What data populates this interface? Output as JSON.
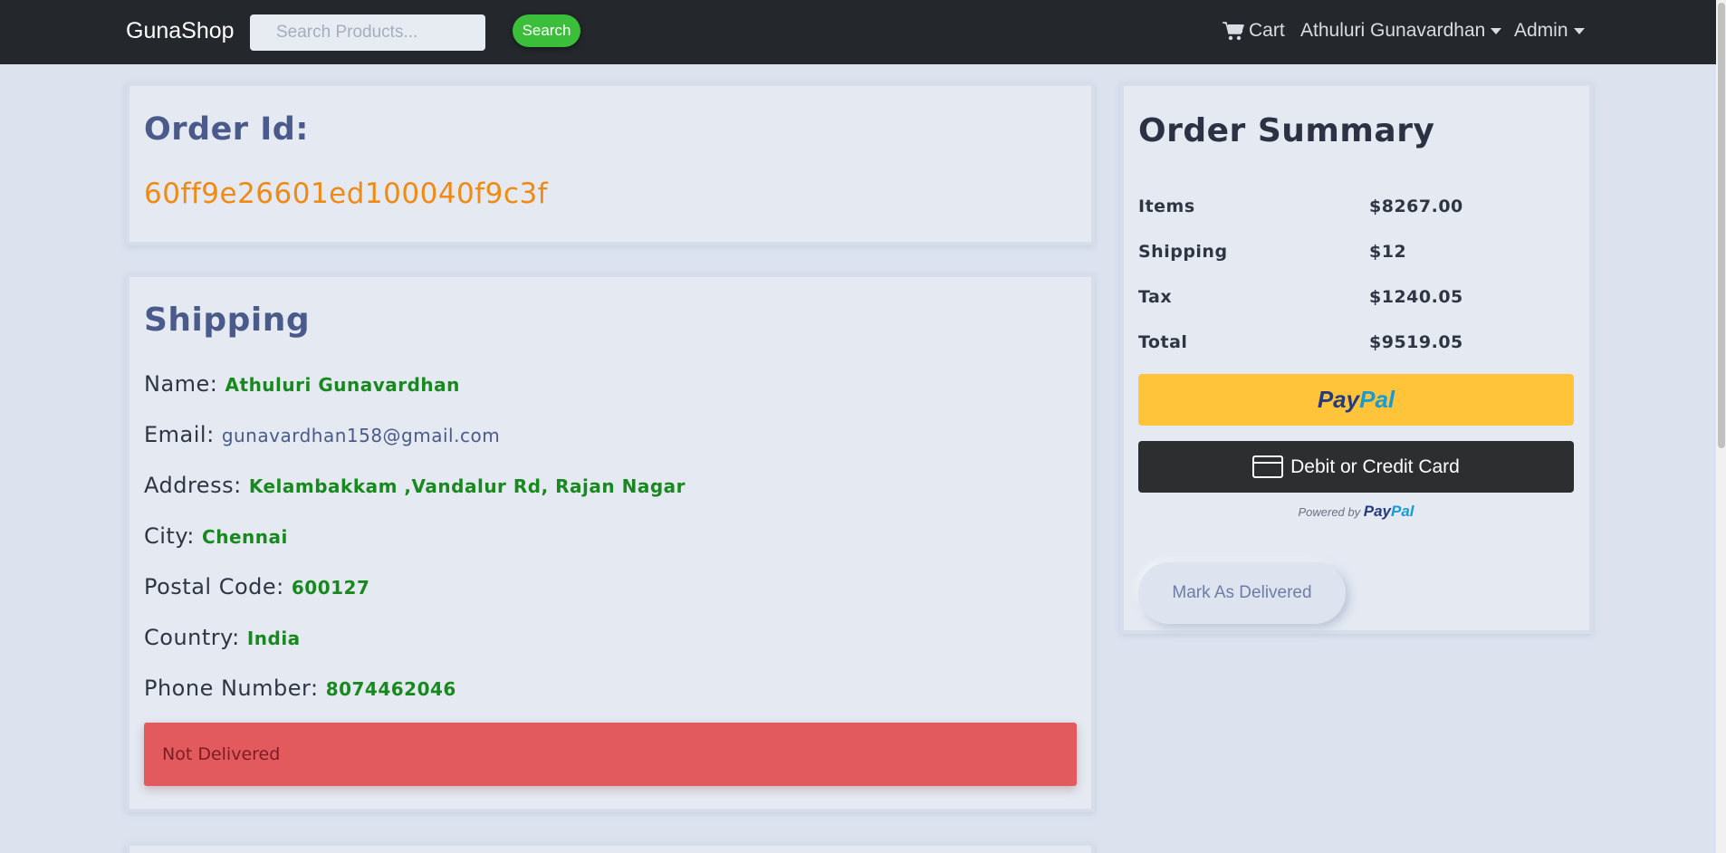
{
  "navbar": {
    "brand": "GunaShop",
    "search_placeholder": "Search Products...",
    "search_button": "Search",
    "cart_label": "Cart",
    "cart_icon": "shopping-cart-icon",
    "user_menu": "Athuluri Gunavardhan",
    "admin_menu": "Admin"
  },
  "order": {
    "title": "Order Id:",
    "id": "60ff9e26601ed100040f9c3f"
  },
  "shipping": {
    "title": "Shipping",
    "name_label": "Name:",
    "name": "Athuluri Gunavardhan",
    "email_label": "Email:",
    "email": "gunavardhan158@gmail.com",
    "address_label": "Address:",
    "address": "Kelambakkam ,Vandalur Rd, Rajan Nagar",
    "city_label": "City:",
    "city": "Chennai",
    "postal_label": "Postal Code:",
    "postal": "600127",
    "country_label": "Country:",
    "country": "India",
    "phone_label": "Phone Number:",
    "phone": "8074462046",
    "status": "Not Delivered"
  },
  "summary": {
    "title": "Order Summary",
    "rows": [
      {
        "label": "Items",
        "value": "$8267.00"
      },
      {
        "label": "Shipping",
        "value": "$12"
      },
      {
        "label": "Tax",
        "value": "$1240.05"
      },
      {
        "label": "Total",
        "value": "$9519.05"
      }
    ],
    "paypal_part1": "Pay",
    "paypal_part2": "Pal",
    "card_button": "Debit or Credit Card",
    "powered_by": "Powered by",
    "mark_delivered": "Mark As Delivered"
  },
  "colors": {
    "navbar": "#24272b",
    "accent_orange": "#f08a12",
    "value_green": "#18891e",
    "alert_red": "#e35a5e",
    "paypal_yellow": "#ffc439",
    "search_green": "#3bbf3b"
  }
}
